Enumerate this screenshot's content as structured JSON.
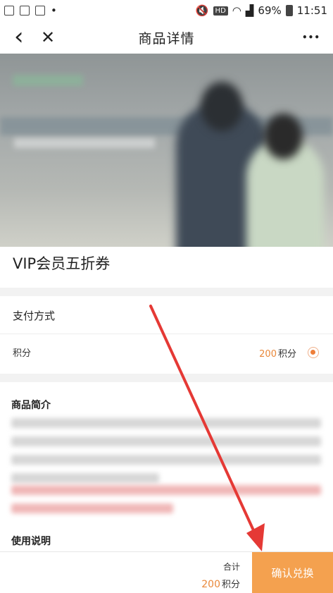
{
  "status_bar": {
    "battery": "69%",
    "time": "11:51",
    "hd": "HD"
  },
  "nav": {
    "title": "商品详情",
    "back": "‹",
    "close": "✕",
    "more": "•••"
  },
  "product": {
    "title": "VIP会员五折券"
  },
  "payment": {
    "header": "支付方式",
    "option_label": "积分",
    "amount": "200",
    "unit": "积分",
    "selected": true
  },
  "sections": {
    "intro_heading": "商品简介",
    "usage_heading": "使用说明"
  },
  "footer": {
    "total_label": "合计",
    "amount": "200",
    "unit": "积分",
    "confirm_label": "确认兑换"
  },
  "colors": {
    "accent": "#f4a14f",
    "amount": "#e9883a",
    "annotation_arrow": "#e53935"
  }
}
